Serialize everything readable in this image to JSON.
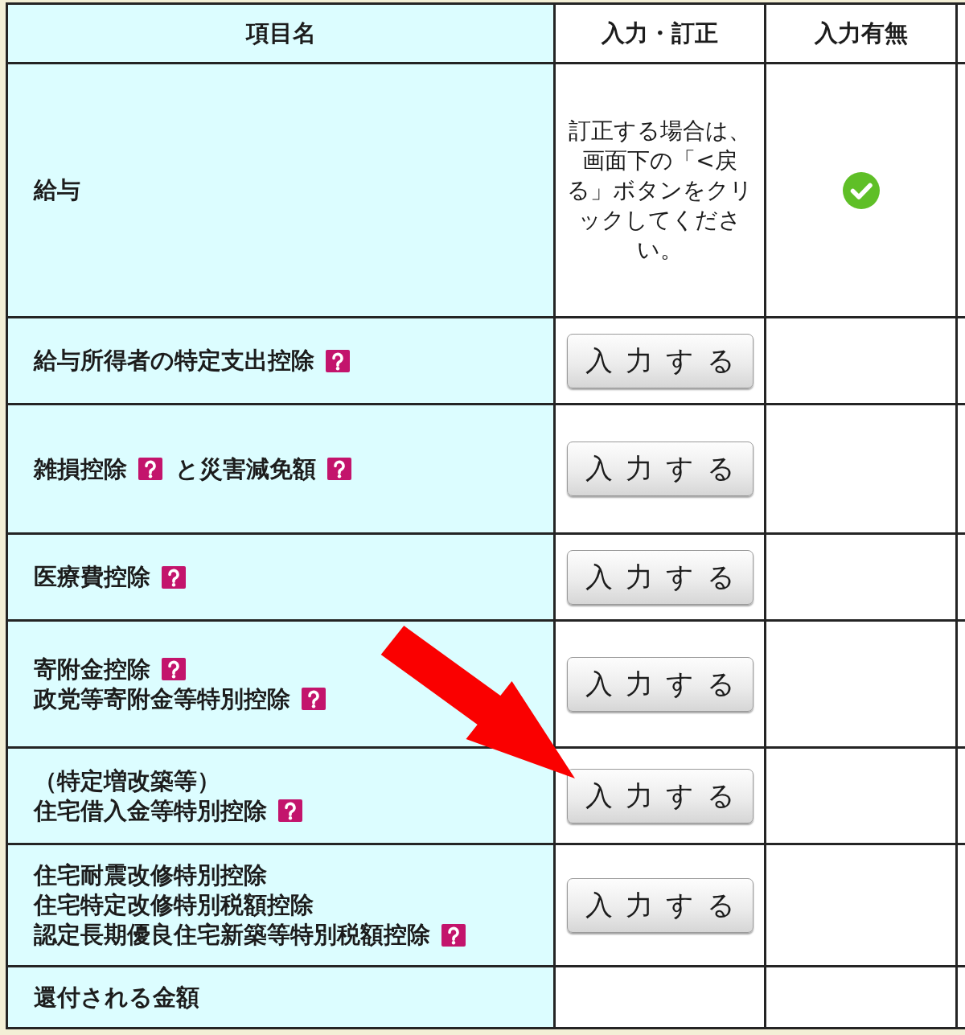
{
  "table": {
    "columns": [
      "項目名",
      "入力・訂正",
      "入力有無"
    ],
    "rows": [
      {
        "label_lines": [
          [
            {
              "text": "給与",
              "help": false
            }
          ]
        ],
        "entry": {
          "kind": "note",
          "text": "訂正する場合は、画面下の「<戻る」ボタンをクリックしてください。"
        },
        "entered": true,
        "arrow": false
      },
      {
        "label_lines": [
          [
            {
              "text": "給与所得者の特定支出控除",
              "help": true
            }
          ]
        ],
        "entry": {
          "kind": "button",
          "label": "入力する"
        },
        "entered": false,
        "arrow": false
      },
      {
        "label_lines": [
          [
            {
              "text": "雑損控除",
              "help": true
            },
            {
              "text": "と災害減免額",
              "help": true
            }
          ]
        ],
        "entry": {
          "kind": "button",
          "label": "入力する"
        },
        "entered": false,
        "arrow": false
      },
      {
        "label_lines": [
          [
            {
              "text": "医療費控除",
              "help": true
            }
          ]
        ],
        "entry": {
          "kind": "button",
          "label": "入力する"
        },
        "entered": false,
        "arrow": false
      },
      {
        "label_lines": [
          [
            {
              "text": "寄附金控除",
              "help": true
            }
          ],
          [
            {
              "text": "政党等寄附金等特別控除",
              "help": true
            }
          ]
        ],
        "entry": {
          "kind": "button",
          "label": "入力する"
        },
        "entered": false,
        "arrow": false
      },
      {
        "label_lines": [
          [
            {
              "text": "（特定増改築等）",
              "help": false
            }
          ],
          [
            {
              "text": "住宅借入金等特別控除",
              "help": true
            }
          ]
        ],
        "entry": {
          "kind": "button",
          "label": "入力する"
        },
        "entered": false,
        "arrow": true
      },
      {
        "label_lines": [
          [
            {
              "text": "住宅耐震改修特別控除",
              "help": false
            }
          ],
          [
            {
              "text": "住宅特定改修特別税額控除",
              "help": false
            }
          ],
          [
            {
              "text": "認定長期優良住宅新築等特別税額控除",
              "help": true
            }
          ]
        ],
        "entry": {
          "kind": "button",
          "label": "入力する"
        },
        "entered": false,
        "arrow": false
      },
      {
        "label_lines": [
          [
            {
              "text": "還付される金額",
              "help": false
            }
          ]
        ],
        "entered": false,
        "arrow": false
      }
    ]
  }
}
